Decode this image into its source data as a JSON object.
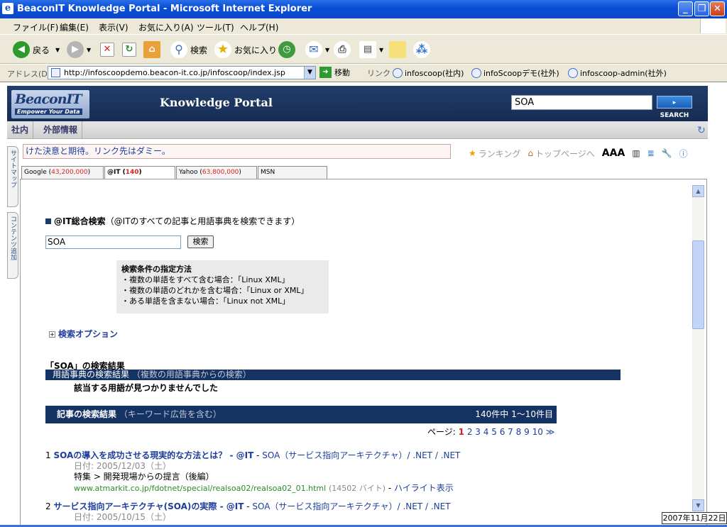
{
  "window": {
    "title": "BeaconIT Knowledge Portal - Microsoft Internet Explorer",
    "icon": "ie-icon"
  },
  "menu": [
    "ファイル(F)",
    "編集(E)",
    "表示(V)",
    "お気に入り(A)",
    "ツール(T)",
    "ヘルプ(H)"
  ],
  "toolbar": {
    "back": "戻る",
    "search": "検索",
    "favorites": "お気に入り"
  },
  "address": {
    "label": "アドレス(D)",
    "url": "http://infoscoopdemo.beacon-it.co.jp/infoscoop/index.jsp",
    "go": "移動",
    "links_label": "リンク",
    "links": [
      "infoscoop(社内)",
      "infoScoopデモ(社外)",
      "infoscoop-admin(社外)"
    ]
  },
  "portal": {
    "logo_main": "BeaconIT",
    "logo_sub": "Empower Your Data",
    "title": "Knowledge Portal",
    "search_value": "SOA",
    "search_button": "SEARCH",
    "nav": [
      "社内",
      "外部情報"
    ],
    "side_tabs": [
      "サイトマップ",
      "コンテンツ追加"
    ],
    "ticker": "けた決意と期待。リンク先はダミー。",
    "tools": {
      "ranking": "ランキング",
      "top": "トップページへ",
      "font": "AAA"
    }
  },
  "tabs": [
    {
      "name": "Google",
      "count": "43,200,000"
    },
    {
      "name": "@IT",
      "count": "140"
    },
    {
      "name": "Yahoo",
      "count": "63,800,000"
    },
    {
      "name": "MSN",
      "count": ""
    }
  ],
  "search": {
    "heading": "@IT総合検索",
    "heading_note": "（@ITのすべての記事と用語事典を検索できます）",
    "input": "SOA",
    "button": "検索",
    "howto_title": "検索条件の指定方法",
    "howto": [
      "・複数の単語をすべて含む場合：「Linux XML」",
      "・複数の単語のどれかを含む場合：「Linux or XML」",
      "・ある単語を含まない場合：「Linux not XML」"
    ],
    "options": "検索オプション",
    "result_title": "「SOA」の検索結果",
    "term_bar": "用語事典の検索結果",
    "term_note": "（複数の用語事典からの検索）",
    "not_found": "該当する用語が見つかりませんでした",
    "article_bar": "記事の検索結果",
    "article_note": "（キーワード広告を含む）",
    "article_count": "140件中 1〜10件目",
    "pages_label": "ページ:",
    "pages": [
      "1",
      "2",
      "3",
      "4",
      "5",
      "6",
      "7",
      "8",
      "9",
      "10"
    ],
    "next": "≫",
    "results": [
      {
        "num": "1",
        "title": "SOAの導入を成功させる現実的な方法とは？ - @IT",
        "cats": "SOA（サービス指向アーキテクチャ）/ .NET / .NET",
        "date": "日付: 2005/12/03（土）",
        "section": "特集 > 開発現場からの提言（後編）",
        "url": "www.atmarkit.co.jp/fdotnet/special/realsoa02/realsoa02_01.html",
        "size": "(14502 バイト)",
        "hl": "ハイライト表示"
      },
      {
        "num": "2",
        "title": "サービス指向アーキテクチャ(SOA)の実際 - @IT",
        "cats": "SOA（サービス指向アーキテクチャ）/ .NET / .NET",
        "date": "日付: 2005/10/15（土）"
      }
    ]
  },
  "clock": "2007年11月22日"
}
